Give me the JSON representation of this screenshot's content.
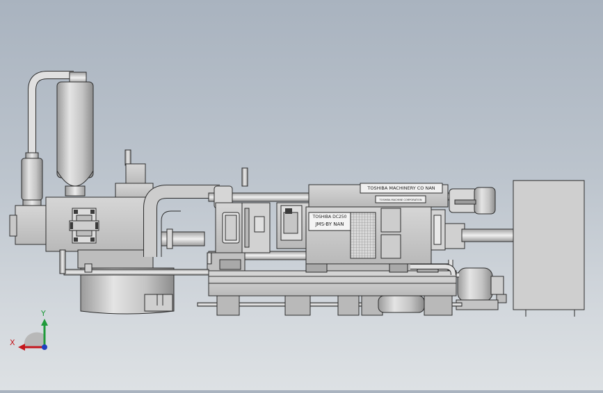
{
  "plate_top": "TOSHIBA MACHINERY CO NAN",
  "plate_top_sub": "TOSHIBA MACHINE CORPORATION",
  "plate_left_line1": "TOSHIBA DC250",
  "plate_left_line2": "JMS-BY NAN",
  "triad": {
    "x_label": "X",
    "y_label": "Y"
  },
  "colors": {
    "metal": "#c9c9c9",
    "metal_light": "#e2e2e2",
    "metal_dark": "#8f8f8f",
    "outline": "#2b2b2b",
    "axis_x": "#c4161c",
    "axis_y": "#1f9a3a",
    "axis_z": "#1f3fbf"
  }
}
